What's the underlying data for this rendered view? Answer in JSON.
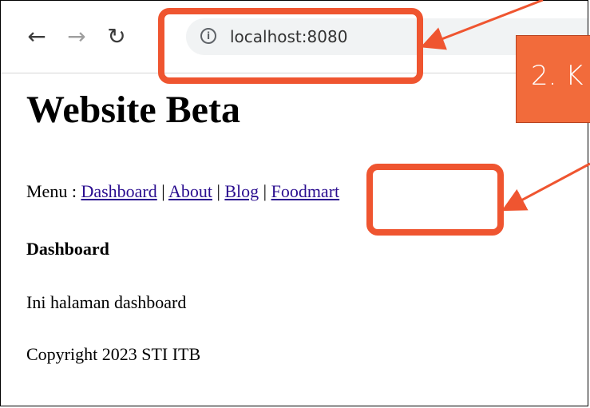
{
  "browser": {
    "url": "localhost:8080",
    "back_icon": "arrow-left-icon",
    "forward_icon": "arrow-right-icon",
    "reload_icon": "reload-icon",
    "info_icon": "info-circle-icon"
  },
  "page": {
    "title": "Website Beta",
    "menu_prefix": "Menu : ",
    "menu_items": [
      "Dashboard",
      "About",
      "Blog",
      "Foodmart"
    ],
    "menu_separator": " | ",
    "section_heading": "Dashboard",
    "body_text": "Ini halaman dashboard",
    "footer_text": "Copyright 2023 STI ITB"
  },
  "annotation": {
    "banner_text": "2. K",
    "accent_color": "#ef5530"
  }
}
